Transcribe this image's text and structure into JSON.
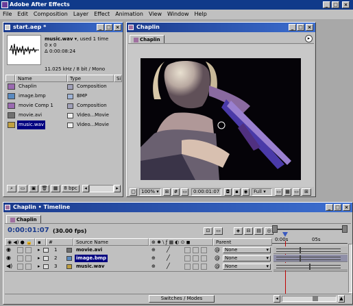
{
  "app": {
    "title": "Adobe After Effects"
  },
  "menu": [
    "File",
    "Edit",
    "Composition",
    "Layer",
    "Effect",
    "Animation",
    "View",
    "Window",
    "Help"
  ],
  "project": {
    "title": "start.aep *",
    "selected_name": "music.wav",
    "selected_used": "▾, used 1 time",
    "info_line1": "0 x 0",
    "info_line2": "Δ 0:00:08:24",
    "info_line3": "11.025 kHz / 8 bit / Mono",
    "col_name": "Name",
    "col_type": "Type",
    "col_extra": "Si",
    "items": [
      {
        "name": "Chaplin",
        "type": "Composition",
        "color": "#a0a0b8",
        "icon": "composition-icon"
      },
      {
        "name": "image.bmp",
        "type": "BMP",
        "color": "#9fb3d6",
        "icon": "image-icon"
      },
      {
        "name": "movie Comp 1",
        "type": "Composition",
        "color": "#a0a0b8",
        "icon": "composition-icon"
      },
      {
        "name": "movie.avi",
        "type": "Video...Movie",
        "color": "#f0f0f0",
        "icon": "film-icon"
      },
      {
        "name": "music.wav",
        "type": "Video...Movie",
        "color": "#f0f0f0",
        "icon": "audio-icon"
      }
    ],
    "bpc": "8 bpc"
  },
  "comp": {
    "window_title": "Chaplin",
    "tab": "Chaplin",
    "zoom": "100%",
    "timecode": "0:00:01:07",
    "resolution": "Full"
  },
  "timeline": {
    "window_title": "Chaplin • Timeline",
    "tab": "Chaplin",
    "current_time": "0:00:01:07",
    "fps": "(30.00 fps)",
    "col_source": "Source Name",
    "col_parent": "Parent",
    "ruler_start": "0:00s",
    "ruler_mid": "05s",
    "switches_label": "Switches / Modes",
    "layers": [
      {
        "num": "1",
        "name": "movie.avi",
        "parent": "None",
        "icon": "film-icon"
      },
      {
        "num": "2",
        "name": "image.bmp",
        "parent": "None",
        "icon": "image-icon"
      },
      {
        "num": "3",
        "name": "music.wav",
        "parent": "None",
        "icon": "audio-icon"
      }
    ]
  },
  "colors": {
    "title_blue": "#1a3a8c",
    "playhead": "#c00000",
    "selection": "#000080"
  }
}
